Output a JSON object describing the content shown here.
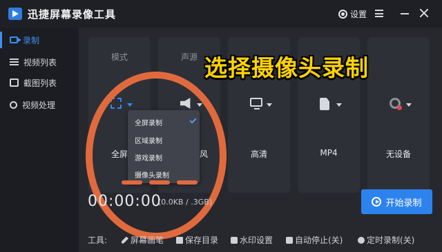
{
  "app": {
    "title": "迅捷屏幕录像工具"
  },
  "header": {
    "settings_label": "设置"
  },
  "sidebar": {
    "items": [
      {
        "label": "录制",
        "icon": "video-icon"
      },
      {
        "label": "视频列表",
        "icon": "list-icon"
      },
      {
        "label": "截图列表",
        "icon": "image-icon"
      },
      {
        "label": "视频处理",
        "icon": "tools-icon"
      }
    ]
  },
  "cards": [
    {
      "title": "模式",
      "value": "全屏",
      "icon": "fullscreen-icon"
    },
    {
      "title": "声源",
      "value": "麦克风",
      "value_visible": "克风",
      "icon": "speaker-icon"
    },
    {
      "title": "",
      "value": "高清",
      "icon": "monitor-icon"
    },
    {
      "title": "",
      "value": "MP4",
      "icon": "file-icon"
    },
    {
      "title": "",
      "value": "无设备",
      "icon": "webcam-icon"
    }
  ],
  "dropdown": {
    "items": [
      "全屏录制",
      "区域录制",
      "游戏录制",
      "摄像头录制"
    ],
    "selected": "全屏录制"
  },
  "overlay": {
    "banner": "选择摄像头录制"
  },
  "status": {
    "timer": "00:00:00",
    "size": "(0.0KB / 7.3GB)",
    "size_visible": "(0.0KB /  .3GB)"
  },
  "record": {
    "start_label": "开始录制"
  },
  "tools": {
    "label": "工具:",
    "items": [
      {
        "label": "屏幕画笔",
        "icon": "pen-icon"
      },
      {
        "label": "保存目录",
        "icon": "save-icon"
      },
      {
        "label": "水印设置",
        "icon": "watermark-icon"
      },
      {
        "label": "自动停止(关)",
        "icon": "pause-icon"
      },
      {
        "label": "定时录制(关)",
        "icon": "clock-icon"
      }
    ]
  },
  "colors": {
    "accent": "#2d83ee",
    "annotation": "#e06a3e",
    "banner": "#ffd300"
  }
}
